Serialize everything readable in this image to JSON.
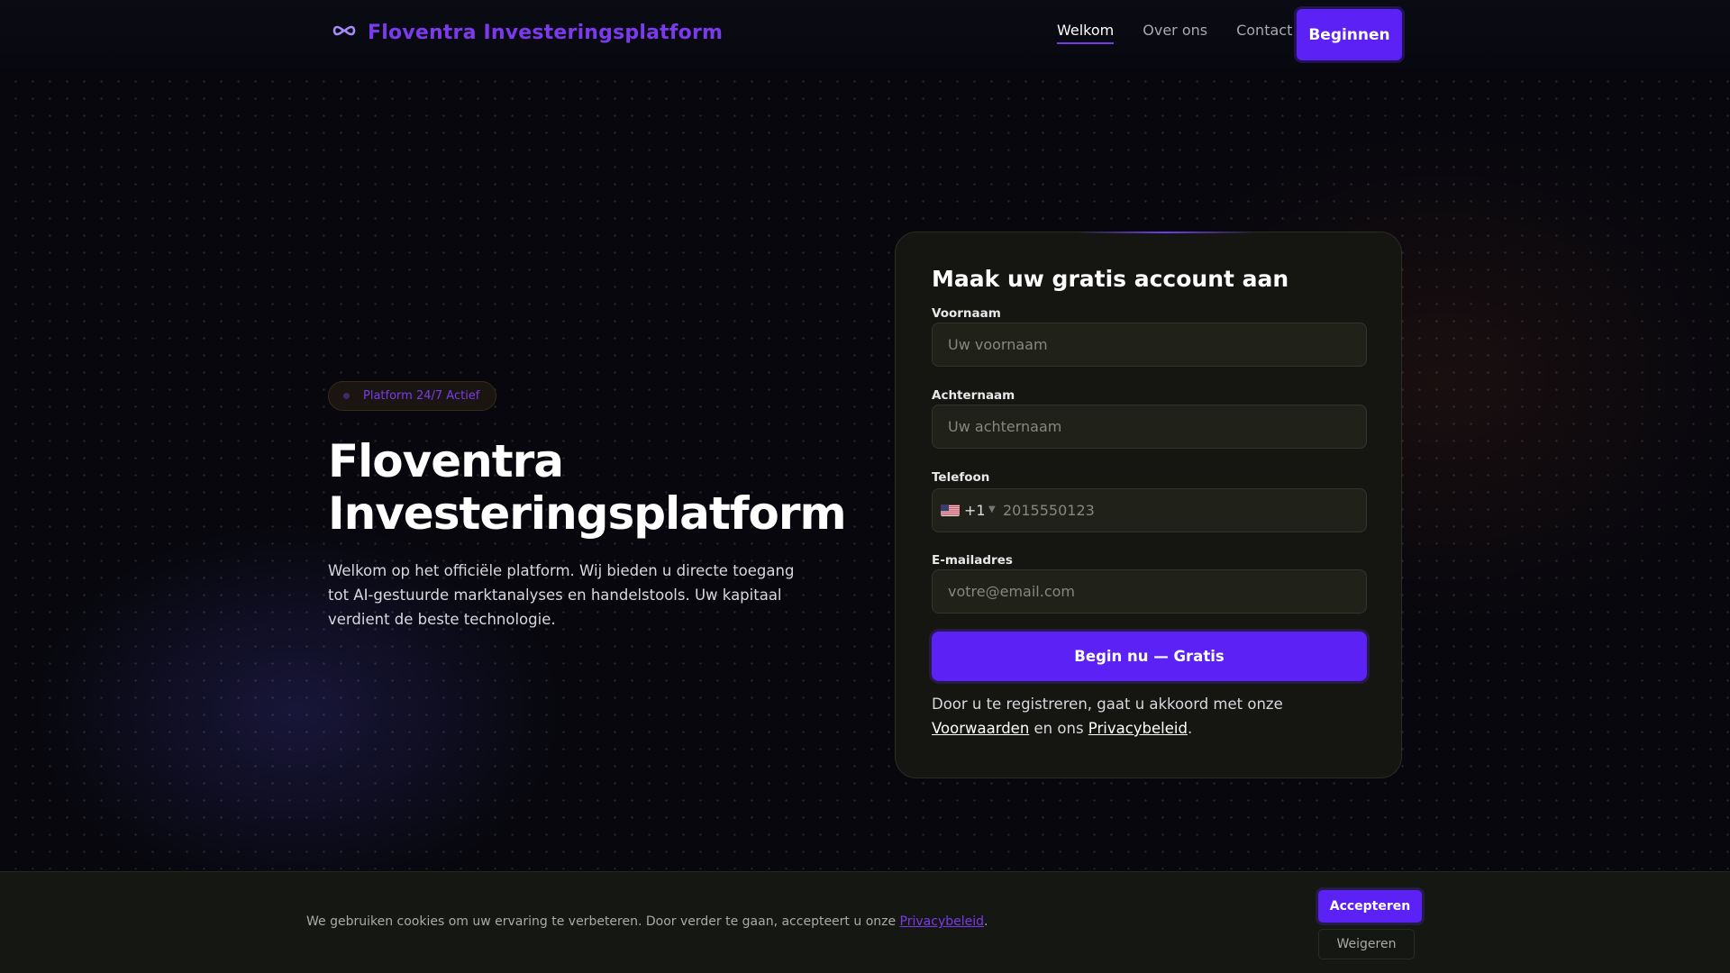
{
  "brand": {
    "name": "Floventra Investeringsplatform",
    "logo_icon": "infinity-loop-icon",
    "accent": "#7c3aed"
  },
  "nav": {
    "items": [
      {
        "label": "Welkom",
        "active": true
      },
      {
        "label": "Over ons",
        "active": false
      },
      {
        "label": "Contact",
        "active": false
      }
    ],
    "cta_label": "Beginnen"
  },
  "hero": {
    "badge": "Platform 24/7 Actief",
    "title_line1": "Floventra",
    "title_line2": "Investeringsplatform",
    "text": "Welkom op het officiële platform. Wij bieden u directe toegang tot AI-gestuurde marktanalyses en handelstools. Uw kapitaal verdient de beste technologie."
  },
  "form": {
    "title": "Maak uw gratis account aan",
    "first_name": {
      "label": "Voornaam",
      "placeholder": "Uw voornaam"
    },
    "last_name": {
      "label": "Achternaam",
      "placeholder": "Uw achternaam"
    },
    "phone": {
      "label": "Telefoon",
      "country_code": "+1",
      "flag_icon": "us-flag-icon",
      "placeholder": "2015550123"
    },
    "email": {
      "label": "E-mailadres",
      "placeholder": "votre@email.com"
    },
    "submit_label": "Begin nu — Gratis",
    "legal_prefix": "Door u te registreren, gaat u akkoord met onze",
    "legal_terms_link": "Voorwaarden",
    "legal_middle": "en ons",
    "legal_privacy_link": "Privacybeleid",
    "legal_suffix": "."
  },
  "cookie": {
    "text": "We gebruiken cookies om uw ervaring te verbeteren. Door verder te gaan, accepteert u onze",
    "link": "Privacybeleid",
    "suffix": ".",
    "accept_label": "Accepteren",
    "decline_label": "Weigeren"
  },
  "colors": {
    "primary": "#5b21f5",
    "accent_text": "#7c3aed",
    "background": "#07070d",
    "card": "#151611"
  }
}
